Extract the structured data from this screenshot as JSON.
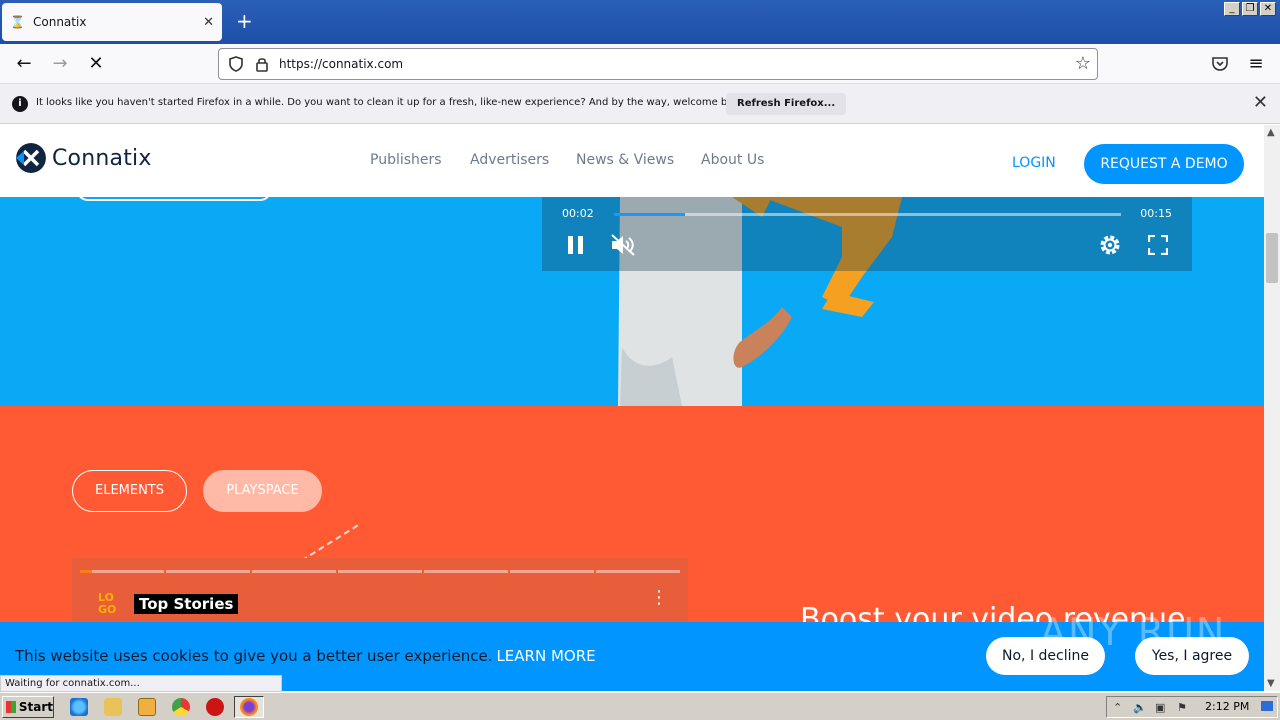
{
  "browser": {
    "tab_title": "Connatix",
    "new_tab": "+",
    "url": "https://connatix.com",
    "notification": {
      "message": "It looks like you haven't started Firefox in a while. Do you want to clean it up for a fresh, like-new experience? And by the way, welcome back!",
      "button": "Refresh Firefox..."
    },
    "status_text": "Waiting for connatix.com..."
  },
  "site": {
    "logo_text": "Connatix",
    "nav": [
      "Publishers",
      "Advertisers",
      "News & Views",
      "About Us"
    ],
    "login": "LOGIN",
    "demo": "REQUEST A DEMO",
    "video": {
      "elapsed": "00:02",
      "duration": "00:15",
      "progress": 0.14
    },
    "pills": {
      "elements": "ELEMENTS",
      "playspace": "PLAYSPACE"
    },
    "player": {
      "logo": "LO GO",
      "label": "Top Stories"
    },
    "headline": "Boost your video revenue",
    "cookie": {
      "message": "This website uses cookies to give you a better user experience.",
      "learn_more": "LEARN MORE",
      "decline": "No, I decline",
      "agree": "Yes, I agree"
    },
    "watermark": "ANY RUN"
  },
  "taskbar": {
    "start": "Start",
    "clock": "2:12 PM"
  },
  "colors": {
    "hero_blue": "#0aa9f6",
    "accent_blue": "#0095ff",
    "orange": "#ff5a33"
  }
}
